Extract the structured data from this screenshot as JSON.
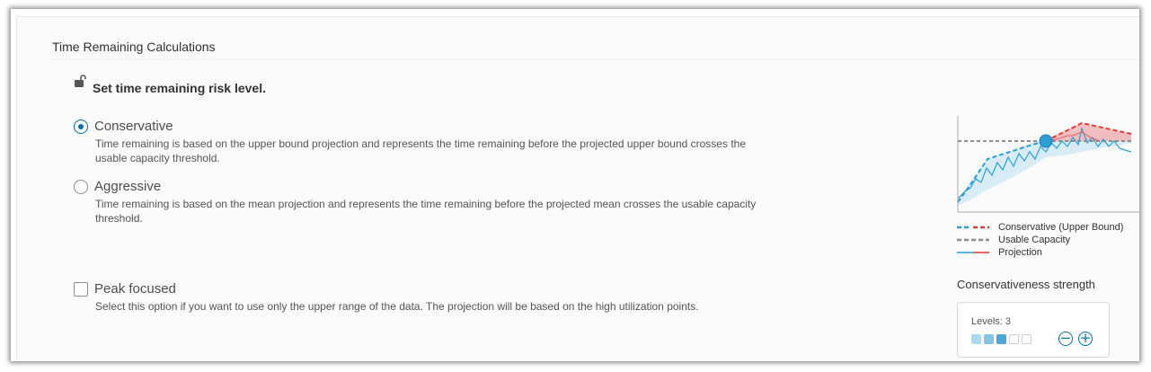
{
  "section_title": "Time Remaining Calculations",
  "risk_level_label": "Set time remaining risk level.",
  "options": {
    "conservative": {
      "label": "Conservative",
      "description": "Time remaining is based on the upper bound projection and represents the time remaining before the projected upper bound crosses the usable capacity threshold.",
      "selected": true
    },
    "aggressive": {
      "label": "Aggressive",
      "description": "Time remaining is based on the mean projection and represents the time remaining before the projected mean crosses the usable capacity threshold.",
      "selected": false
    }
  },
  "peak_focused": {
    "label": "Peak focused",
    "description": "Select this option if you want to use only the upper range of the data. The projection will be based on the high utilization points.",
    "checked": false
  },
  "legend": {
    "conservative": "Conservative (Upper Bound)",
    "usable_capacity": "Usable Capacity",
    "projection": "Projection"
  },
  "conservativeness": {
    "title": "Conservativeness strength",
    "levels_label": "Levels: 3",
    "level": 3,
    "max_levels": 5
  },
  "icons": {
    "lock": "unlock-icon",
    "minus": "minus-circle-icon",
    "plus": "plus-circle-icon"
  },
  "colors": {
    "accent": "#0072a3",
    "upper_bound": "#e53935",
    "projection": "#2a9fd6",
    "capacity": "#8c8c8c"
  }
}
